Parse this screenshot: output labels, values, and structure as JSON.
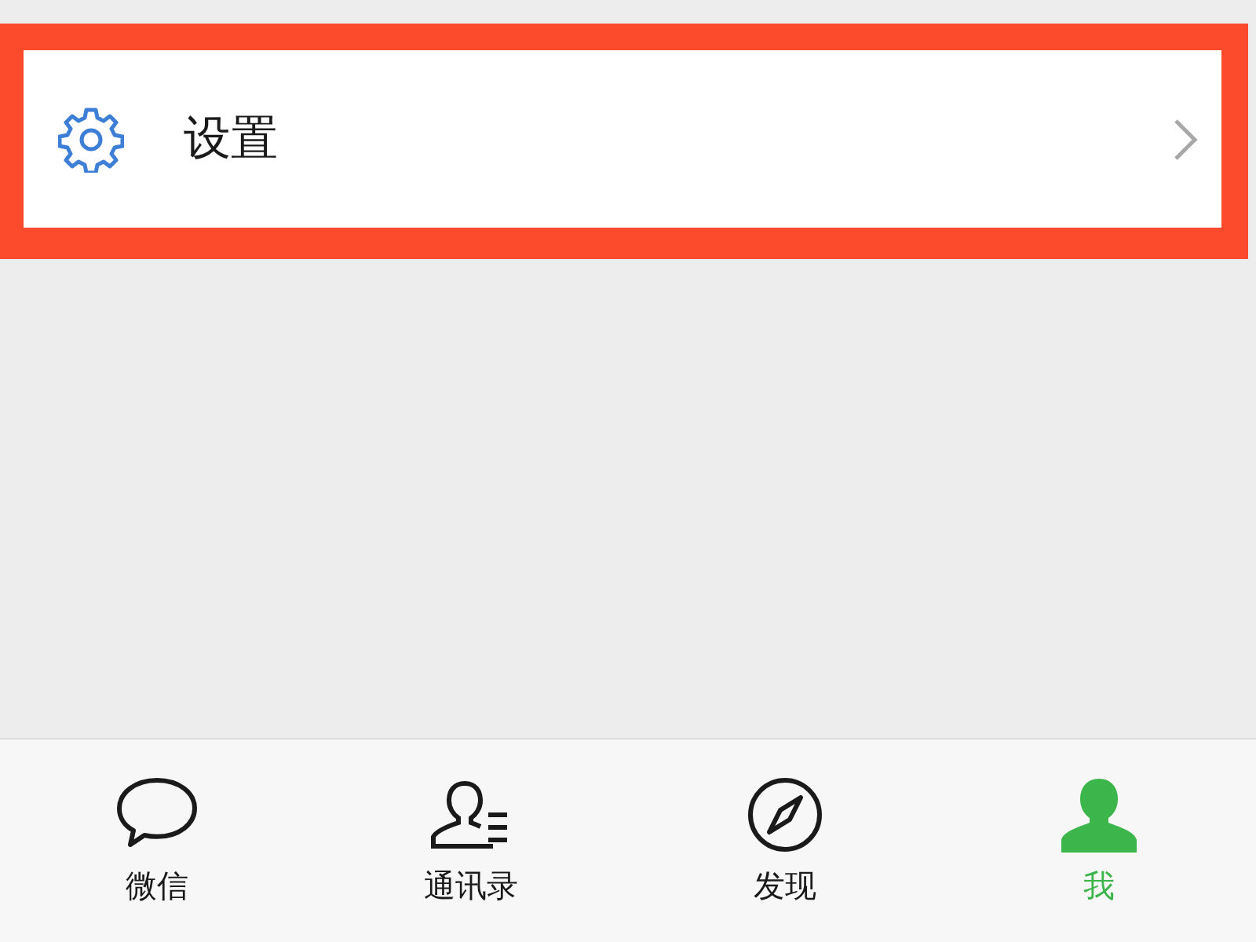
{
  "settings_row": {
    "label": "设置",
    "highlighted": true
  },
  "tabs": [
    {
      "label": "微信",
      "kind": "chat",
      "selected": false
    },
    {
      "label": "通讯录",
      "kind": "contacts",
      "selected": false
    },
    {
      "label": "发现",
      "kind": "discover",
      "selected": false
    },
    {
      "label": "我",
      "kind": "me",
      "selected": true
    }
  ]
}
